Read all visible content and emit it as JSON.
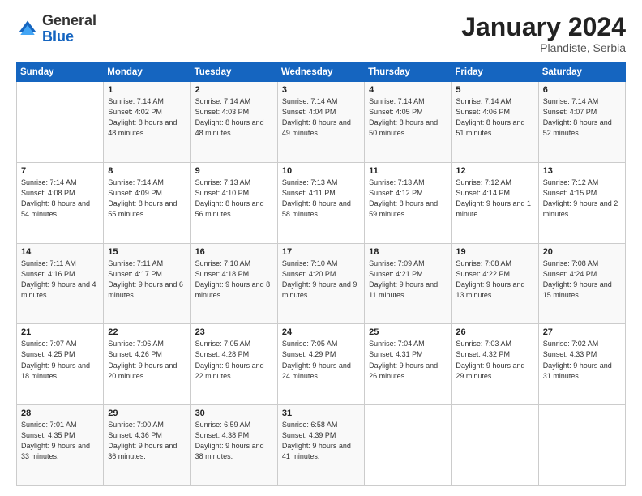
{
  "header": {
    "logo_general": "General",
    "logo_blue": "Blue",
    "month_title": "January 2024",
    "location": "Plandiste, Serbia"
  },
  "days_of_week": [
    "Sunday",
    "Monday",
    "Tuesday",
    "Wednesday",
    "Thursday",
    "Friday",
    "Saturday"
  ],
  "weeks": [
    [
      {
        "day": "",
        "info": ""
      },
      {
        "day": "1",
        "info": "Sunrise: 7:14 AM\nSunset: 4:02 PM\nDaylight: 8 hours and 48 minutes."
      },
      {
        "day": "2",
        "info": "Sunrise: 7:14 AM\nSunset: 4:03 PM\nDaylight: 8 hours and 48 minutes."
      },
      {
        "day": "3",
        "info": "Sunrise: 7:14 AM\nSunset: 4:04 PM\nDaylight: 8 hours and 49 minutes."
      },
      {
        "day": "4",
        "info": "Sunrise: 7:14 AM\nSunset: 4:05 PM\nDaylight: 8 hours and 50 minutes."
      },
      {
        "day": "5",
        "info": "Sunrise: 7:14 AM\nSunset: 4:06 PM\nDaylight: 8 hours and 51 minutes."
      },
      {
        "day": "6",
        "info": "Sunrise: 7:14 AM\nSunset: 4:07 PM\nDaylight: 8 hours and 52 minutes."
      }
    ],
    [
      {
        "day": "7",
        "info": "Sunrise: 7:14 AM\nSunset: 4:08 PM\nDaylight: 8 hours and 54 minutes."
      },
      {
        "day": "8",
        "info": "Sunrise: 7:14 AM\nSunset: 4:09 PM\nDaylight: 8 hours and 55 minutes."
      },
      {
        "day": "9",
        "info": "Sunrise: 7:13 AM\nSunset: 4:10 PM\nDaylight: 8 hours and 56 minutes."
      },
      {
        "day": "10",
        "info": "Sunrise: 7:13 AM\nSunset: 4:11 PM\nDaylight: 8 hours and 58 minutes."
      },
      {
        "day": "11",
        "info": "Sunrise: 7:13 AM\nSunset: 4:12 PM\nDaylight: 8 hours and 59 minutes."
      },
      {
        "day": "12",
        "info": "Sunrise: 7:12 AM\nSunset: 4:14 PM\nDaylight: 9 hours and 1 minute."
      },
      {
        "day": "13",
        "info": "Sunrise: 7:12 AM\nSunset: 4:15 PM\nDaylight: 9 hours and 2 minutes."
      }
    ],
    [
      {
        "day": "14",
        "info": "Sunrise: 7:11 AM\nSunset: 4:16 PM\nDaylight: 9 hours and 4 minutes."
      },
      {
        "day": "15",
        "info": "Sunrise: 7:11 AM\nSunset: 4:17 PM\nDaylight: 9 hours and 6 minutes."
      },
      {
        "day": "16",
        "info": "Sunrise: 7:10 AM\nSunset: 4:18 PM\nDaylight: 9 hours and 8 minutes."
      },
      {
        "day": "17",
        "info": "Sunrise: 7:10 AM\nSunset: 4:20 PM\nDaylight: 9 hours and 9 minutes."
      },
      {
        "day": "18",
        "info": "Sunrise: 7:09 AM\nSunset: 4:21 PM\nDaylight: 9 hours and 11 minutes."
      },
      {
        "day": "19",
        "info": "Sunrise: 7:08 AM\nSunset: 4:22 PM\nDaylight: 9 hours and 13 minutes."
      },
      {
        "day": "20",
        "info": "Sunrise: 7:08 AM\nSunset: 4:24 PM\nDaylight: 9 hours and 15 minutes."
      }
    ],
    [
      {
        "day": "21",
        "info": "Sunrise: 7:07 AM\nSunset: 4:25 PM\nDaylight: 9 hours and 18 minutes."
      },
      {
        "day": "22",
        "info": "Sunrise: 7:06 AM\nSunset: 4:26 PM\nDaylight: 9 hours and 20 minutes."
      },
      {
        "day": "23",
        "info": "Sunrise: 7:05 AM\nSunset: 4:28 PM\nDaylight: 9 hours and 22 minutes."
      },
      {
        "day": "24",
        "info": "Sunrise: 7:05 AM\nSunset: 4:29 PM\nDaylight: 9 hours and 24 minutes."
      },
      {
        "day": "25",
        "info": "Sunrise: 7:04 AM\nSunset: 4:31 PM\nDaylight: 9 hours and 26 minutes."
      },
      {
        "day": "26",
        "info": "Sunrise: 7:03 AM\nSunset: 4:32 PM\nDaylight: 9 hours and 29 minutes."
      },
      {
        "day": "27",
        "info": "Sunrise: 7:02 AM\nSunset: 4:33 PM\nDaylight: 9 hours and 31 minutes."
      }
    ],
    [
      {
        "day": "28",
        "info": "Sunrise: 7:01 AM\nSunset: 4:35 PM\nDaylight: 9 hours and 33 minutes."
      },
      {
        "day": "29",
        "info": "Sunrise: 7:00 AM\nSunset: 4:36 PM\nDaylight: 9 hours and 36 minutes."
      },
      {
        "day": "30",
        "info": "Sunrise: 6:59 AM\nSunset: 4:38 PM\nDaylight: 9 hours and 38 minutes."
      },
      {
        "day": "31",
        "info": "Sunrise: 6:58 AM\nSunset: 4:39 PM\nDaylight: 9 hours and 41 minutes."
      },
      {
        "day": "",
        "info": ""
      },
      {
        "day": "",
        "info": ""
      },
      {
        "day": "",
        "info": ""
      }
    ]
  ]
}
